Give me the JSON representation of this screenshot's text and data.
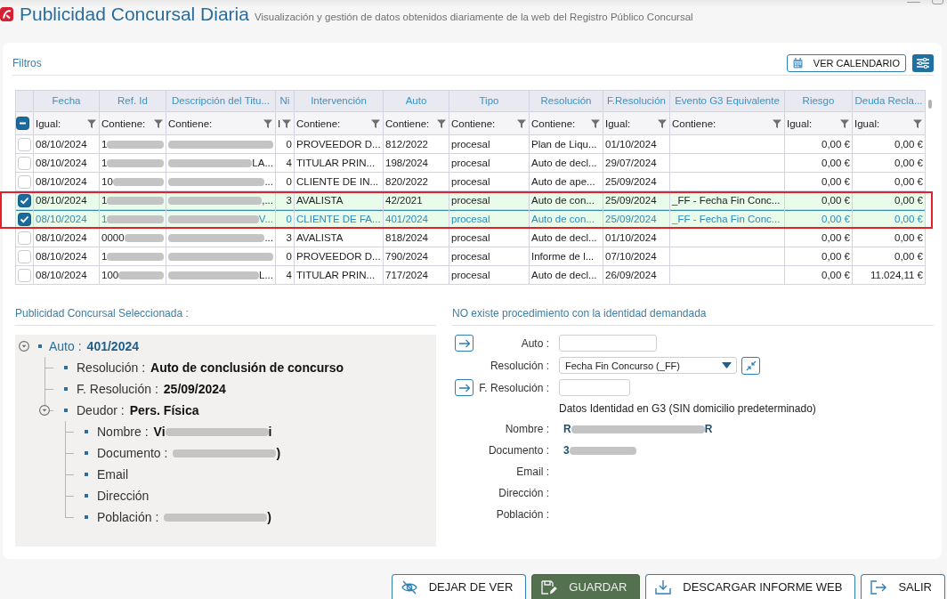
{
  "window": {
    "title": "Publicidad Concursal Diaria",
    "subtitle": "Visualización y gestión de datos obtenidos diariamente de la web del Registro Público Concursal"
  },
  "filters": {
    "title": "Filtros",
    "calendar_button": "VER CALENDARIO"
  },
  "table": {
    "select_all": {
      "indeterminate": true
    },
    "columns": [
      {
        "label": "Fecha",
        "filter": "Igual:"
      },
      {
        "label": "Ref. Id",
        "filter": "Contiene:"
      },
      {
        "label": "Descripción del Titu...",
        "filter": "Contiene:"
      },
      {
        "label": "Ni",
        "filter": "I"
      },
      {
        "label": "Intervención",
        "filter": "Contiene:"
      },
      {
        "label": "Auto",
        "filter": "Contiene:"
      },
      {
        "label": "Tipo",
        "filter": "Contiene:"
      },
      {
        "label": "Resolución",
        "filter": "Contiene:"
      },
      {
        "label": "F.Resolución",
        "filter": "Igual:"
      },
      {
        "label": "Evento G3 Equivalente",
        "filter": "Contiene:"
      },
      {
        "label": "Riesgo",
        "filter": "Igual:"
      },
      {
        "label": "Deuda Recla...",
        "filter": "Igual:"
      }
    ],
    "rows": [
      {
        "checked": false,
        "selected": false,
        "highlighted": false,
        "cells": [
          "08/10/2024",
          [
            {
              "kind": "text",
              "text": "1"
            },
            {
              "kind": "redacted"
            }
          ],
          [
            {
              "kind": "redacted"
            }
          ],
          "0",
          "PROVEEDOR D...",
          "812/2022",
          "procesal",
          "Plan de Liqu...",
          "01/10/2024",
          null,
          "0,00 €",
          "0,00 €"
        ]
      },
      {
        "checked": false,
        "selected": false,
        "highlighted": false,
        "cells": [
          "08/10/2024",
          [
            {
              "kind": "text",
              "text": "1"
            },
            {
              "kind": "redacted"
            }
          ],
          [
            {
              "kind": "redacted"
            },
            {
              "kind": "text",
              "text": "LA..."
            }
          ],
          "4",
          "TITULAR PRIN...",
          "198/2024",
          "procesal",
          "Auto de decl...",
          "29/07/2024",
          null,
          "0,00 €",
          "0,00 €"
        ]
      },
      {
        "checked": false,
        "selected": false,
        "highlighted": false,
        "cells": [
          "08/10/2024",
          [
            {
              "kind": "text",
              "text": "10"
            },
            {
              "kind": "redacted"
            }
          ],
          [
            {
              "kind": "redacted"
            },
            {
              "kind": "text",
              "text": "..."
            }
          ],
          "0",
          "CLIENTE DE IN...",
          "820/2022",
          "procesal",
          "Auto de ape...",
          "25/09/2024",
          null,
          "0,00 €",
          "0,00 €"
        ]
      },
      {
        "checked": true,
        "selected": false,
        "highlighted": true,
        "cells": [
          "08/10/2024",
          [
            {
              "kind": "text",
              "text": "1"
            },
            {
              "kind": "redacted"
            }
          ],
          [
            {
              "kind": "redacted"
            },
            {
              "kind": "text",
              "text": ",..."
            }
          ],
          "3",
          "AVALISTA",
          "42/2021",
          "procesal",
          "Auto de con...",
          "25/09/2024",
          "_FF - Fecha Fin Conc...",
          "0,00 €",
          "0,00 €"
        ]
      },
      {
        "checked": true,
        "selected": true,
        "highlighted": true,
        "cells": [
          "08/10/2024",
          [
            {
              "kind": "text",
              "text": "1"
            },
            {
              "kind": "redacted"
            }
          ],
          [
            {
              "kind": "redacted"
            },
            {
              "kind": "text",
              "text": "V..."
            }
          ],
          "0",
          "CLIENTE DE FA...",
          "401/2024",
          "procesal",
          "Auto de con...",
          "25/09/2024",
          "_FF - Fecha Fin Conc...",
          "0,00 €",
          "0,00 €"
        ]
      },
      {
        "checked": false,
        "selected": false,
        "highlighted": false,
        "cells": [
          "08/10/2024",
          [
            {
              "kind": "text",
              "text": "0000"
            },
            {
              "kind": "redacted"
            }
          ],
          [
            {
              "kind": "redacted"
            },
            {
              "kind": "text",
              "text": "..."
            }
          ],
          "3",
          "AVALISTA",
          "818/2024",
          "procesal",
          "Auto de decl...",
          "01/10/2024",
          null,
          "0,00 €",
          "0,00 €"
        ]
      },
      {
        "checked": false,
        "selected": false,
        "highlighted": false,
        "cells": [
          "08/10/2024",
          [
            {
              "kind": "text",
              "text": "1"
            },
            {
              "kind": "redacted"
            }
          ],
          [
            {
              "kind": "redacted"
            }
          ],
          "0",
          "PROVEEDOR D...",
          "790/2024",
          "procesal",
          "Informe de l...",
          "07/10/2024",
          null,
          "0,00 €",
          "0,00 €"
        ]
      },
      {
        "checked": false,
        "selected": false,
        "highlighted": false,
        "cells": [
          "08/10/2024",
          [
            {
              "kind": "text",
              "text": "100"
            },
            {
              "kind": "redacted"
            }
          ],
          [
            {
              "kind": "redacted"
            },
            {
              "kind": "text",
              "text": "L..."
            }
          ],
          "4",
          "TITULAR PRIN...",
          "717/2024",
          "procesal",
          "Auto de decl...",
          "26/09/2024",
          null,
          "0,00 €",
          "11.024,11 €"
        ]
      }
    ]
  },
  "selected_item": {
    "title": "Publicidad Concursal Seleccionada :",
    "tree": [
      {
        "label": "Auto :",
        "value": "401/2024",
        "expanded": true,
        "children": [
          {
            "label": "Resolución :",
            "value": "Auto de conclusión de concurso"
          },
          {
            "label": "F. Resolución :",
            "value": "25/09/2024"
          },
          {
            "label": "Deudor :",
            "value": "Pers. Física",
            "expanded": true,
            "children": [
              {
                "label": "Nombre :",
                "value": [
                  {
                    "kind": "text",
                    "text": "Vi"
                  },
                  {
                    "kind": "redacted"
                  },
                  {
                    "kind": "text",
                    "text": "i"
                  }
                ]
              },
              {
                "label": "Documento :",
                "value": [
                  {
                    "kind": "redacted"
                  },
                  {
                    "kind": "text",
                    "text": ")"
                  }
                ]
              },
              {
                "label": "Email"
              },
              {
                "label": "Dirección"
              },
              {
                "label": "Población :",
                "value": [
                  {
                    "kind": "redacted"
                  },
                  {
                    "kind": "text",
                    "text": ")"
                  }
                ]
              }
            ]
          }
        ]
      }
    ]
  },
  "identity": {
    "title": "NO existe procedimiento con la identidad demandada",
    "fields": [
      {
        "kind": "text_input",
        "label": "Auto :",
        "go_button": true
      },
      {
        "kind": "select",
        "label": "Resolución :",
        "value": "Fecha Fin Concurso (_FF)",
        "go_button": false
      },
      {
        "kind": "date_input",
        "label": "F. Resolución :",
        "go_button": true
      }
    ],
    "g3_title": "Datos Identidad en G3 (SIN domicilio predeterminado)",
    "g3_fields": [
      {
        "label": "Nombre :",
        "value": [
          {
            "kind": "text",
            "text": "R"
          },
          {
            "kind": "redacted"
          },
          {
            "kind": "text",
            "text": "R"
          }
        ]
      },
      {
        "label": "Documento :",
        "value": [
          {
            "kind": "text",
            "text": "3"
          },
          {
            "kind": "redacted"
          }
        ]
      },
      {
        "label": "Email :"
      },
      {
        "label": "Dirección :"
      },
      {
        "label": "Población :"
      }
    ]
  },
  "buttons": [
    {
      "label": "DEJAR DE VER",
      "primary": false
    },
    {
      "label": "GUARDAR",
      "primary": true
    },
    {
      "label": "DESCARGAR INFORME WEB",
      "primary": false
    },
    {
      "label": "SALIR",
      "primary": false
    }
  ]
}
